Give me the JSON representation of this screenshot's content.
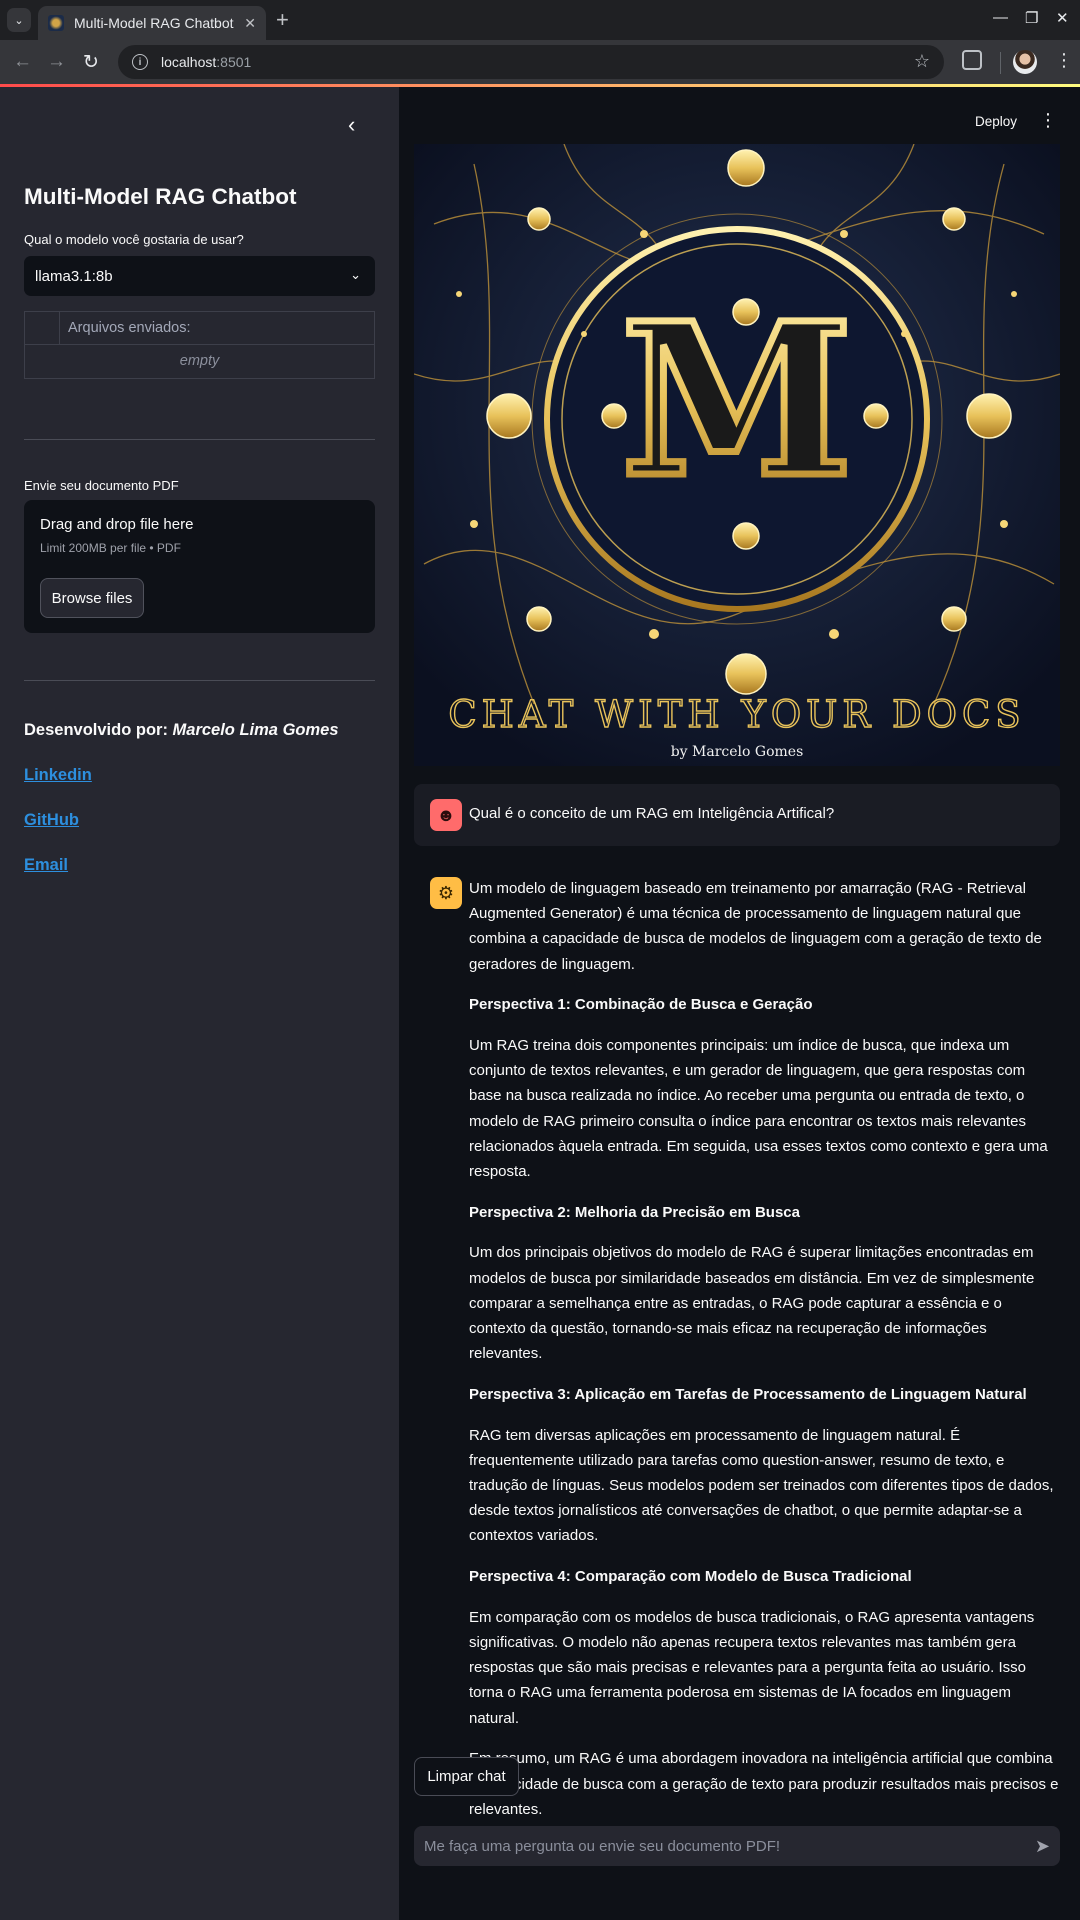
{
  "browser": {
    "tab_title": "Multi-Model RAG Chatbot",
    "url_host": "localhost",
    "url_port": ":8501"
  },
  "sidebar": {
    "title": "Multi-Model RAG Chatbot",
    "model_label": "Qual o modelo você gostaria de usar?",
    "model_selected": "llama3.1:8b",
    "files_header": "Arquivos enviados:",
    "files_empty": "empty",
    "upload_label": "Envie seu documento PDF",
    "upload_main": "Drag and drop file here",
    "upload_sub": "Limit 200MB per file • PDF",
    "browse_label": "Browse files",
    "developer_prefix": "Desenvolvido por: ",
    "developer_name": "Marcelo Lima Gomes",
    "links": [
      "Linkedin",
      "GitHub",
      "Email"
    ]
  },
  "header": {
    "deploy_label": "Deploy"
  },
  "banner": {
    "letter": "M",
    "title": "CHAT WITH YOUR DOCS",
    "byline": "by Marcelo Gomes"
  },
  "chat": {
    "user_message": "Qual é o conceito de um RAG em Inteligência Artifical?",
    "assistant": {
      "intro": "Um modelo de linguagem baseado em treinamento por amarração (RAG - Retrieval Augmented Generator) é uma técnica de processamento de linguagem natural que combina a capacidade de busca de modelos de linguagem com a geração de texto de geradores de linguagem.",
      "sections": [
        {
          "heading": "Perspectiva 1: Combinação de Busca e Geração",
          "body": "Um RAG treina dois componentes principais: um índice de busca, que indexa um conjunto de textos relevantes, e um gerador de linguagem, que gera respostas com base na busca realizada no índice. Ao receber uma pergunta ou entrada de texto, o modelo de RAG primeiro consulta o índice para encontrar os textos mais relevantes relacionados àquela entrada. Em seguida, usa esses textos como contexto e gera uma resposta."
        },
        {
          "heading": "Perspectiva 2: Melhoria da Precisão em Busca",
          "body": "Um dos principais objetivos do modelo de RAG é superar limitações encontradas em modelos de busca por similaridade baseados em distância. Em vez de simplesmente comparar a semelhança entre as entradas, o RAG pode capturar a essência e o contexto da questão, tornando-se mais eficaz na recuperação de informações relevantes."
        },
        {
          "heading": "Perspectiva 3: Aplicação em Tarefas de Processamento de Linguagem Natural",
          "body": "RAG tem diversas aplicações em processamento de linguagem natural. É frequentemente utilizado para tarefas como question-answer, resumo de texto, e tradução de línguas. Seus modelos podem ser treinados com diferentes tipos de dados, desde textos jornalísticos até conversações de chatbot, o que permite adaptar-se a contextos variados."
        },
        {
          "heading": "Perspectiva 4: Comparação com Modelo de Busca Tradicional",
          "body": "Em comparação com os modelos de busca tradicionais, o RAG apresenta vantagens significativas. O modelo não apenas recupera textos relevantes mas também gera respostas que são mais precisas e relevantes para a pergunta feita ao usuário. Isso torna o RAG uma ferramenta poderosa em sistemas de IA focados em linguagem natural."
        }
      ],
      "conclusion": "Em resumo, um RAG é uma abordagem inovadora na inteligência artificial que combina a capacidade de busca com a geração de texto para produzir resultados mais precisos e relevantes."
    },
    "clear_label": "Limpar chat",
    "input_placeholder": "Me faça uma pergunta ou envie seu documento PDF!"
  },
  "colors": {
    "sidebar_bg": "#262730",
    "main_bg": "#0e1117",
    "link": "#2d8fde",
    "gold": "#e8c25a",
    "user_avatar": "#ff6b6b",
    "bot_avatar": "#ffbd45"
  }
}
